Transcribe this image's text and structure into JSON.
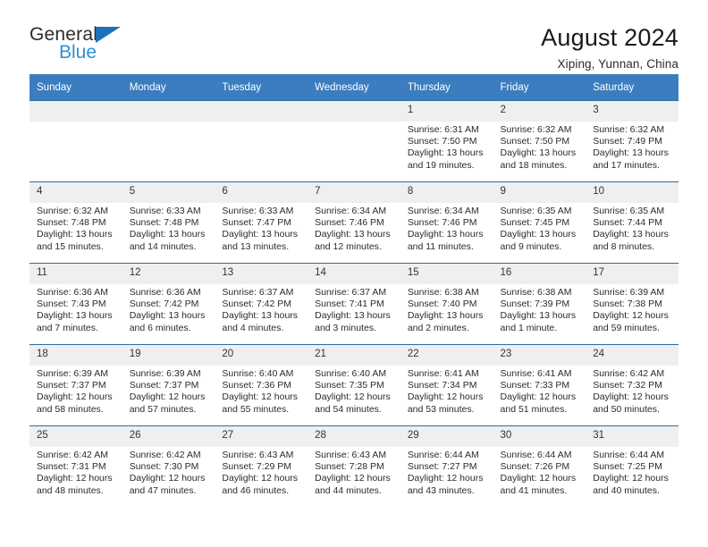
{
  "brand": {
    "name_part1": "General",
    "name_part2": "Blue",
    "triangle_color": "#1d71b8",
    "blue_text_color": "#2f8fd6"
  },
  "header": {
    "title": "August 2024",
    "subtitle": "Xiping, Yunnan, China",
    "header_bg": "#3b7dbf",
    "row_divider": "#2e6da4",
    "daynum_bg": "#efefef"
  },
  "weekdays": [
    "Sunday",
    "Monday",
    "Tuesday",
    "Wednesday",
    "Thursday",
    "Friday",
    "Saturday"
  ],
  "weeks": [
    [
      {
        "day": "",
        "lines": []
      },
      {
        "day": "",
        "lines": []
      },
      {
        "day": "",
        "lines": []
      },
      {
        "day": "",
        "lines": []
      },
      {
        "day": "1",
        "lines": [
          "Sunrise: 6:31 AM",
          "Sunset: 7:50 PM",
          "Daylight: 13 hours",
          "and 19 minutes."
        ]
      },
      {
        "day": "2",
        "lines": [
          "Sunrise: 6:32 AM",
          "Sunset: 7:50 PM",
          "Daylight: 13 hours",
          "and 18 minutes."
        ]
      },
      {
        "day": "3",
        "lines": [
          "Sunrise: 6:32 AM",
          "Sunset: 7:49 PM",
          "Daylight: 13 hours",
          "and 17 minutes."
        ]
      }
    ],
    [
      {
        "day": "4",
        "lines": [
          "Sunrise: 6:32 AM",
          "Sunset: 7:48 PM",
          "Daylight: 13 hours",
          "and 15 minutes."
        ]
      },
      {
        "day": "5",
        "lines": [
          "Sunrise: 6:33 AM",
          "Sunset: 7:48 PM",
          "Daylight: 13 hours",
          "and 14 minutes."
        ]
      },
      {
        "day": "6",
        "lines": [
          "Sunrise: 6:33 AM",
          "Sunset: 7:47 PM",
          "Daylight: 13 hours",
          "and 13 minutes."
        ]
      },
      {
        "day": "7",
        "lines": [
          "Sunrise: 6:34 AM",
          "Sunset: 7:46 PM",
          "Daylight: 13 hours",
          "and 12 minutes."
        ]
      },
      {
        "day": "8",
        "lines": [
          "Sunrise: 6:34 AM",
          "Sunset: 7:46 PM",
          "Daylight: 13 hours",
          "and 11 minutes."
        ]
      },
      {
        "day": "9",
        "lines": [
          "Sunrise: 6:35 AM",
          "Sunset: 7:45 PM",
          "Daylight: 13 hours",
          "and 9 minutes."
        ]
      },
      {
        "day": "10",
        "lines": [
          "Sunrise: 6:35 AM",
          "Sunset: 7:44 PM",
          "Daylight: 13 hours",
          "and 8 minutes."
        ]
      }
    ],
    [
      {
        "day": "11",
        "lines": [
          "Sunrise: 6:36 AM",
          "Sunset: 7:43 PM",
          "Daylight: 13 hours",
          "and 7 minutes."
        ]
      },
      {
        "day": "12",
        "lines": [
          "Sunrise: 6:36 AM",
          "Sunset: 7:42 PM",
          "Daylight: 13 hours",
          "and 6 minutes."
        ]
      },
      {
        "day": "13",
        "lines": [
          "Sunrise: 6:37 AM",
          "Sunset: 7:42 PM",
          "Daylight: 13 hours",
          "and 4 minutes."
        ]
      },
      {
        "day": "14",
        "lines": [
          "Sunrise: 6:37 AM",
          "Sunset: 7:41 PM",
          "Daylight: 13 hours",
          "and 3 minutes."
        ]
      },
      {
        "day": "15",
        "lines": [
          "Sunrise: 6:38 AM",
          "Sunset: 7:40 PM",
          "Daylight: 13 hours",
          "and 2 minutes."
        ]
      },
      {
        "day": "16",
        "lines": [
          "Sunrise: 6:38 AM",
          "Sunset: 7:39 PM",
          "Daylight: 13 hours",
          "and 1 minute."
        ]
      },
      {
        "day": "17",
        "lines": [
          "Sunrise: 6:39 AM",
          "Sunset: 7:38 PM",
          "Daylight: 12 hours",
          "and 59 minutes."
        ]
      }
    ],
    [
      {
        "day": "18",
        "lines": [
          "Sunrise: 6:39 AM",
          "Sunset: 7:37 PM",
          "Daylight: 12 hours",
          "and 58 minutes."
        ]
      },
      {
        "day": "19",
        "lines": [
          "Sunrise: 6:39 AM",
          "Sunset: 7:37 PM",
          "Daylight: 12 hours",
          "and 57 minutes."
        ]
      },
      {
        "day": "20",
        "lines": [
          "Sunrise: 6:40 AM",
          "Sunset: 7:36 PM",
          "Daylight: 12 hours",
          "and 55 minutes."
        ]
      },
      {
        "day": "21",
        "lines": [
          "Sunrise: 6:40 AM",
          "Sunset: 7:35 PM",
          "Daylight: 12 hours",
          "and 54 minutes."
        ]
      },
      {
        "day": "22",
        "lines": [
          "Sunrise: 6:41 AM",
          "Sunset: 7:34 PM",
          "Daylight: 12 hours",
          "and 53 minutes."
        ]
      },
      {
        "day": "23",
        "lines": [
          "Sunrise: 6:41 AM",
          "Sunset: 7:33 PM",
          "Daylight: 12 hours",
          "and 51 minutes."
        ]
      },
      {
        "day": "24",
        "lines": [
          "Sunrise: 6:42 AM",
          "Sunset: 7:32 PM",
          "Daylight: 12 hours",
          "and 50 minutes."
        ]
      }
    ],
    [
      {
        "day": "25",
        "lines": [
          "Sunrise: 6:42 AM",
          "Sunset: 7:31 PM",
          "Daylight: 12 hours",
          "and 48 minutes."
        ]
      },
      {
        "day": "26",
        "lines": [
          "Sunrise: 6:42 AM",
          "Sunset: 7:30 PM",
          "Daylight: 12 hours",
          "and 47 minutes."
        ]
      },
      {
        "day": "27",
        "lines": [
          "Sunrise: 6:43 AM",
          "Sunset: 7:29 PM",
          "Daylight: 12 hours",
          "and 46 minutes."
        ]
      },
      {
        "day": "28",
        "lines": [
          "Sunrise: 6:43 AM",
          "Sunset: 7:28 PM",
          "Daylight: 12 hours",
          "and 44 minutes."
        ]
      },
      {
        "day": "29",
        "lines": [
          "Sunrise: 6:44 AM",
          "Sunset: 7:27 PM",
          "Daylight: 12 hours",
          "and 43 minutes."
        ]
      },
      {
        "day": "30",
        "lines": [
          "Sunrise: 6:44 AM",
          "Sunset: 7:26 PM",
          "Daylight: 12 hours",
          "and 41 minutes."
        ]
      },
      {
        "day": "31",
        "lines": [
          "Sunrise: 6:44 AM",
          "Sunset: 7:25 PM",
          "Daylight: 12 hours",
          "and 40 minutes."
        ]
      }
    ]
  ]
}
